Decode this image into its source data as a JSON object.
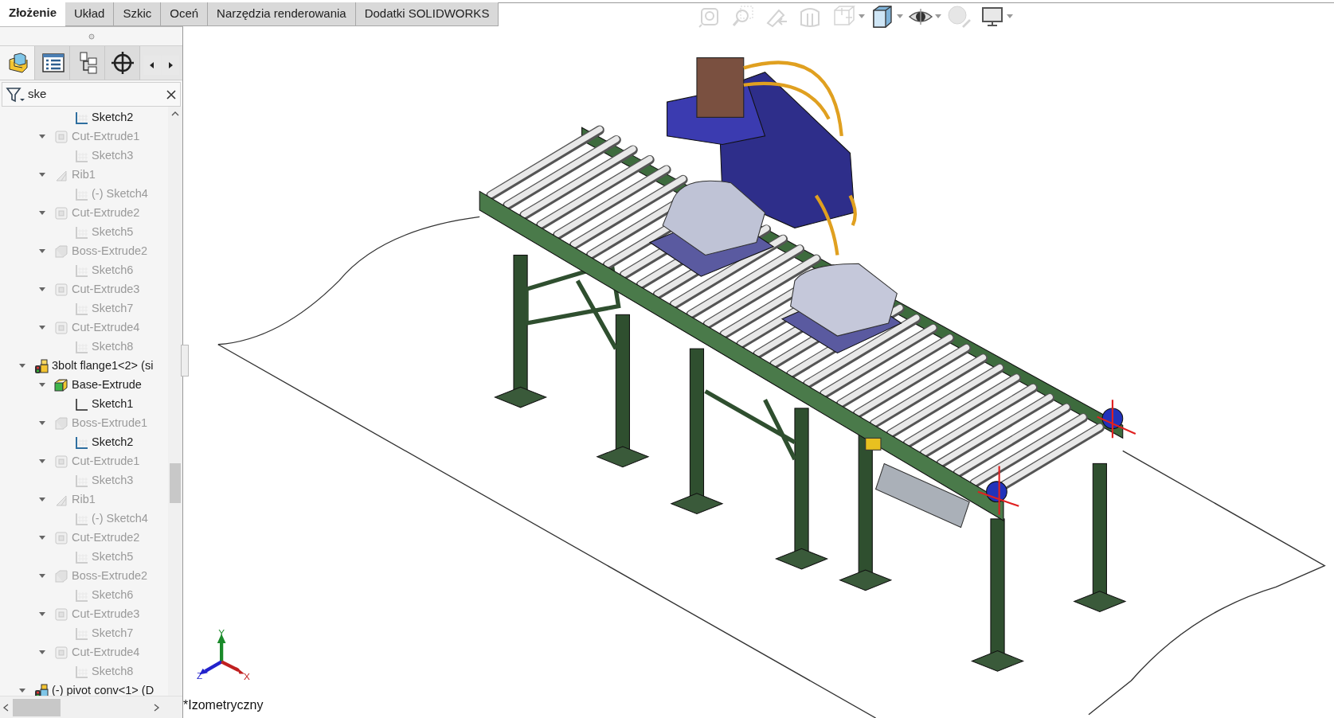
{
  "ribbon_tabs": [
    {
      "label": "Złożenie",
      "selected": true
    },
    {
      "label": "Układ",
      "selected": false
    },
    {
      "label": "Szkic",
      "selected": false
    },
    {
      "label": "Oceń",
      "selected": false
    },
    {
      "label": "Narzędzia renderowania",
      "selected": false
    },
    {
      "label": "Dodatki SOLIDWORKS",
      "selected": false
    }
  ],
  "view_toolbar": [
    {
      "kind": "zoom_fit",
      "disabled": true,
      "dropdown": false
    },
    {
      "kind": "zoom_area",
      "disabled": true,
      "dropdown": false
    },
    {
      "kind": "previous_view",
      "disabled": true,
      "dropdown": false
    },
    {
      "kind": "section_view",
      "disabled": true,
      "dropdown": false
    },
    {
      "kind": "view_orientation",
      "disabled": true,
      "dropdown": true
    },
    {
      "kind": "display_style",
      "disabled": false,
      "dropdown": true
    },
    {
      "kind": "hide_show",
      "disabled": false,
      "dropdown": true
    },
    {
      "kind": "appearance",
      "disabled": true,
      "dropdown": false
    },
    {
      "kind": "scene",
      "disabled": false,
      "dropdown": true
    }
  ],
  "panel_tabs": [
    {
      "kind": "feature_tree",
      "selected": true
    },
    {
      "kind": "property",
      "selected": false
    },
    {
      "kind": "configuration",
      "selected": false
    },
    {
      "kind": "dimxpert",
      "selected": false
    }
  ],
  "filter": {
    "value": "ske"
  },
  "tree": [
    {
      "children": [
        {
          "children": [
            {
              "label": "Sketch2",
              "kind": "sketch",
              "dimmed": false
            }
          ]
        },
        {
          "label": "Cut-Extrude1",
          "kind": "cut",
          "dimmed": true,
          "expanded": true,
          "children": [
            {
              "label": "Sketch3",
              "kind": "sketch",
              "dimmed": true
            }
          ]
        },
        {
          "label": "Rib1",
          "kind": "rib",
          "dimmed": true,
          "expanded": true,
          "children": [
            {
              "label": "(-) Sketch4",
              "kind": "sketch",
              "dimmed": true
            }
          ]
        },
        {
          "label": "Cut-Extrude2",
          "kind": "cut",
          "dimmed": true,
          "expanded": true,
          "children": [
            {
              "label": "Sketch5",
              "kind": "sketch",
              "dimmed": true
            }
          ]
        },
        {
          "label": "Boss-Extrude2",
          "kind": "boss",
          "dimmed": true,
          "expanded": true,
          "children": [
            {
              "label": "Sketch6",
              "kind": "sketch",
              "dimmed": true
            }
          ]
        },
        {
          "label": "Cut-Extrude3",
          "kind": "cut",
          "dimmed": true,
          "expanded": true,
          "children": [
            {
              "label": "Sketch7",
              "kind": "sketch",
              "dimmed": true
            }
          ]
        },
        {
          "label": "Cut-Extrude4",
          "kind": "cut",
          "dimmed": true,
          "expanded": true,
          "children": [
            {
              "label": "Sketch8",
              "kind": "sketch",
              "dimmed": true
            }
          ]
        }
      ]
    },
    {
      "label": "3bolt flange1<2> (si",
      "kind": "part",
      "dimmed": false,
      "expanded": true,
      "children": [
        {
          "label": "Base-Extrude",
          "kind": "base",
          "dimmed": false,
          "expanded": true,
          "children": [
            {
              "label": "Sketch1",
              "kind": "sketch_plain",
              "dimmed": false
            }
          ]
        },
        {
          "label": "Boss-Extrude1",
          "kind": "boss",
          "dimmed": true,
          "expanded": true,
          "children": [
            {
              "label": "Sketch2",
              "kind": "sketch",
              "dimmed": false
            }
          ]
        },
        {
          "label": "Cut-Extrude1",
          "kind": "cut",
          "dimmed": true,
          "expanded": true,
          "children": [
            {
              "label": "Sketch3",
              "kind": "sketch",
              "dimmed": true
            }
          ]
        },
        {
          "label": "Rib1",
          "kind": "rib",
          "dimmed": true,
          "expanded": true,
          "children": [
            {
              "label": "(-) Sketch4",
              "kind": "sketch",
              "dimmed": true
            }
          ]
        },
        {
          "label": "Cut-Extrude2",
          "kind": "cut",
          "dimmed": true,
          "expanded": true,
          "children": [
            {
              "label": "Sketch5",
              "kind": "sketch",
              "dimmed": true
            }
          ]
        },
        {
          "label": "Boss-Extrude2",
          "kind": "boss",
          "dimmed": true,
          "expanded": true,
          "children": [
            {
              "label": "Sketch6",
              "kind": "sketch",
              "dimmed": true
            }
          ]
        },
        {
          "label": "Cut-Extrude3",
          "kind": "cut",
          "dimmed": true,
          "expanded": true,
          "children": [
            {
              "label": "Sketch7",
              "kind": "sketch",
              "dimmed": true
            }
          ]
        },
        {
          "label": "Cut-Extrude4",
          "kind": "cut",
          "dimmed": true,
          "expanded": true,
          "children": [
            {
              "label": "Sketch8",
              "kind": "sketch",
              "dimmed": true
            }
          ]
        }
      ]
    },
    {
      "label": "(-) pivot conv<1> (D",
      "kind": "part_blue",
      "dimmed": false,
      "expanded": true
    }
  ],
  "triad": {
    "x": "X",
    "y": "Y",
    "z": "Z"
  },
  "view_label": "*Izometryczny"
}
